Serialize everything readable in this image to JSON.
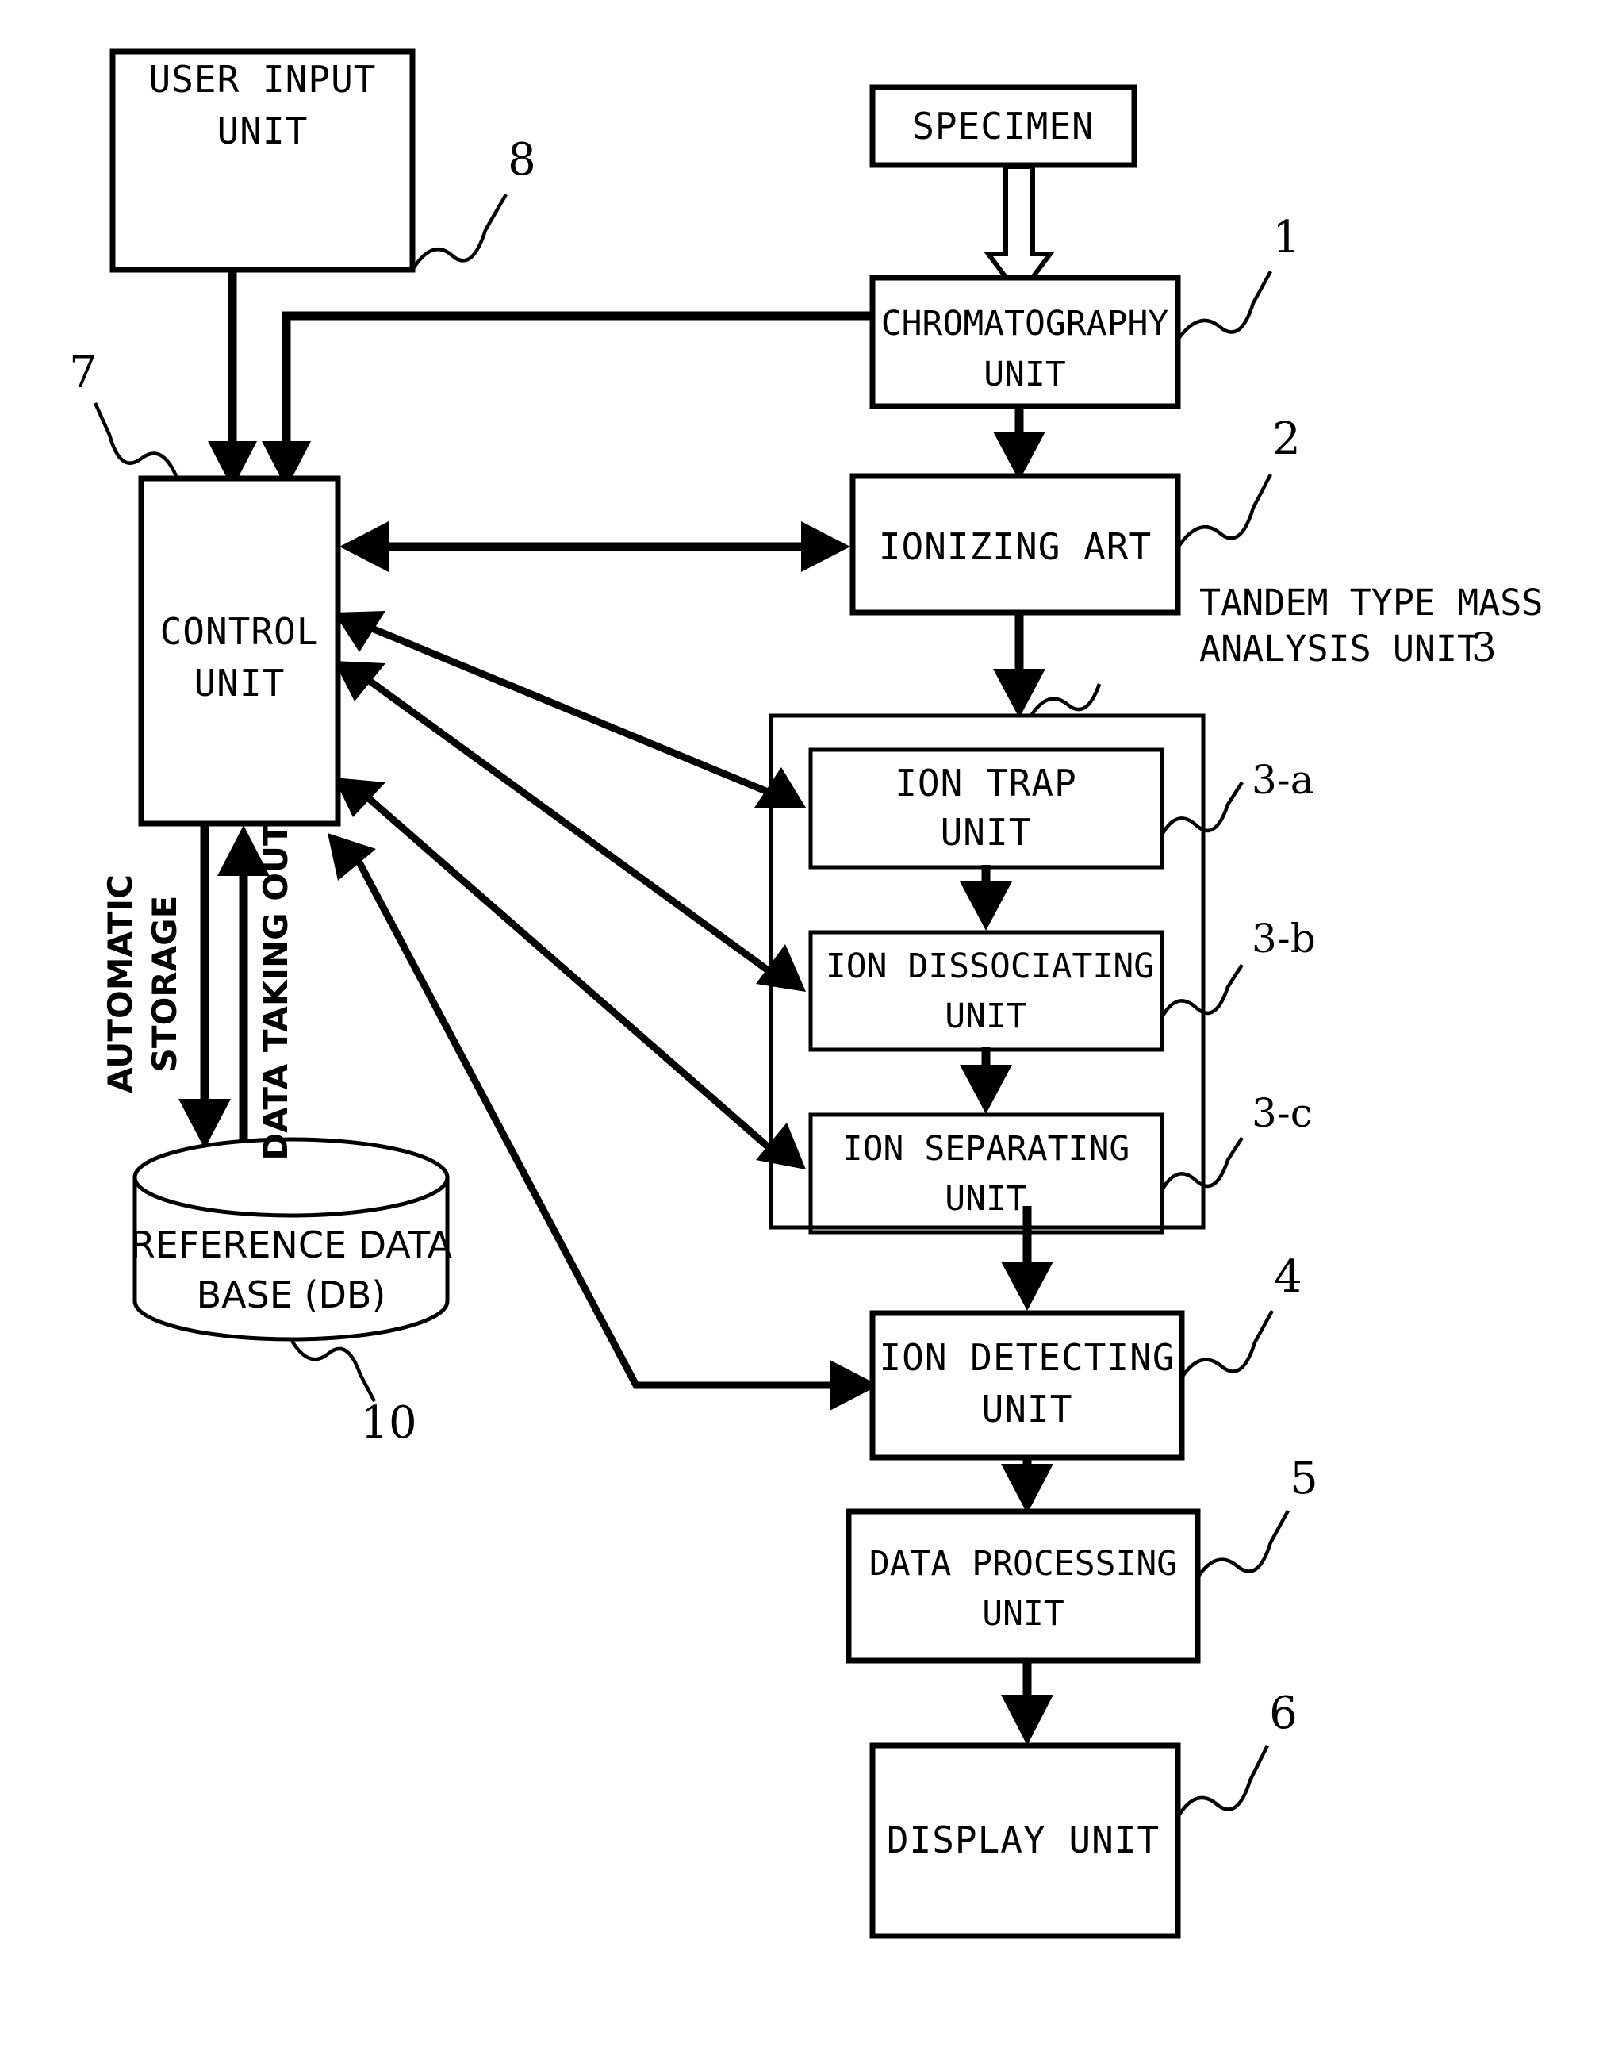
{
  "figure": {
    "type": "patent-block-diagram",
    "title": "Mass analysis system block diagram"
  },
  "boxes": {
    "user_input": {
      "label_line1": "USER INPUT",
      "label_line2": "UNIT",
      "ref": "8"
    },
    "specimen": {
      "label_line1": "SPECIMEN",
      "ref": ""
    },
    "chromatography": {
      "label_line1": "CHROMATOGRAPHY",
      "label_line2": "UNIT",
      "ref": "1"
    },
    "ionizing": {
      "label_line1": "IONIZING ART",
      "ref": "2"
    },
    "control": {
      "label_line1": "CONTROL",
      "label_line2": "UNIT",
      "ref": "7"
    },
    "ion_trap": {
      "label_line1": "ION TRAP",
      "label_line2": "UNIT",
      "ref": "3-a"
    },
    "ion_dissociating": {
      "label_line1": "ION DISSOCIATING",
      "label_line2": "UNIT",
      "ref": "3-b"
    },
    "ion_separating": {
      "label_line1": "ION SEPARATING",
      "label_line2": "UNIT",
      "ref": "3-c"
    },
    "ion_detecting": {
      "label_line1": "ION DETECTING",
      "label_line2": "UNIT",
      "ref": "4"
    },
    "data_processing": {
      "label_line1": "DATA PROCESSING",
      "label_line2": "UNIT",
      "ref": "5"
    },
    "display": {
      "label_line1": "DISPLAY UNIT",
      "ref": "6"
    },
    "database": {
      "label_line1": "REFERENCE DATA",
      "label_line2": "BASE (DB)",
      "ref": "10"
    }
  },
  "group": {
    "tandem_label_line1": "TANDEM TYPE MASS",
    "tandem_label_line2": "ANALYSIS UNIT",
    "tandem_ref": "3"
  },
  "flow_labels": {
    "automatic_storage_line1": "AUTOMATIC",
    "automatic_storage_line2": "STORAGE",
    "data_taking_out": "DATA TAKING OUT"
  },
  "colors": {
    "ink": "#000000",
    "paper": "#ffffff"
  }
}
